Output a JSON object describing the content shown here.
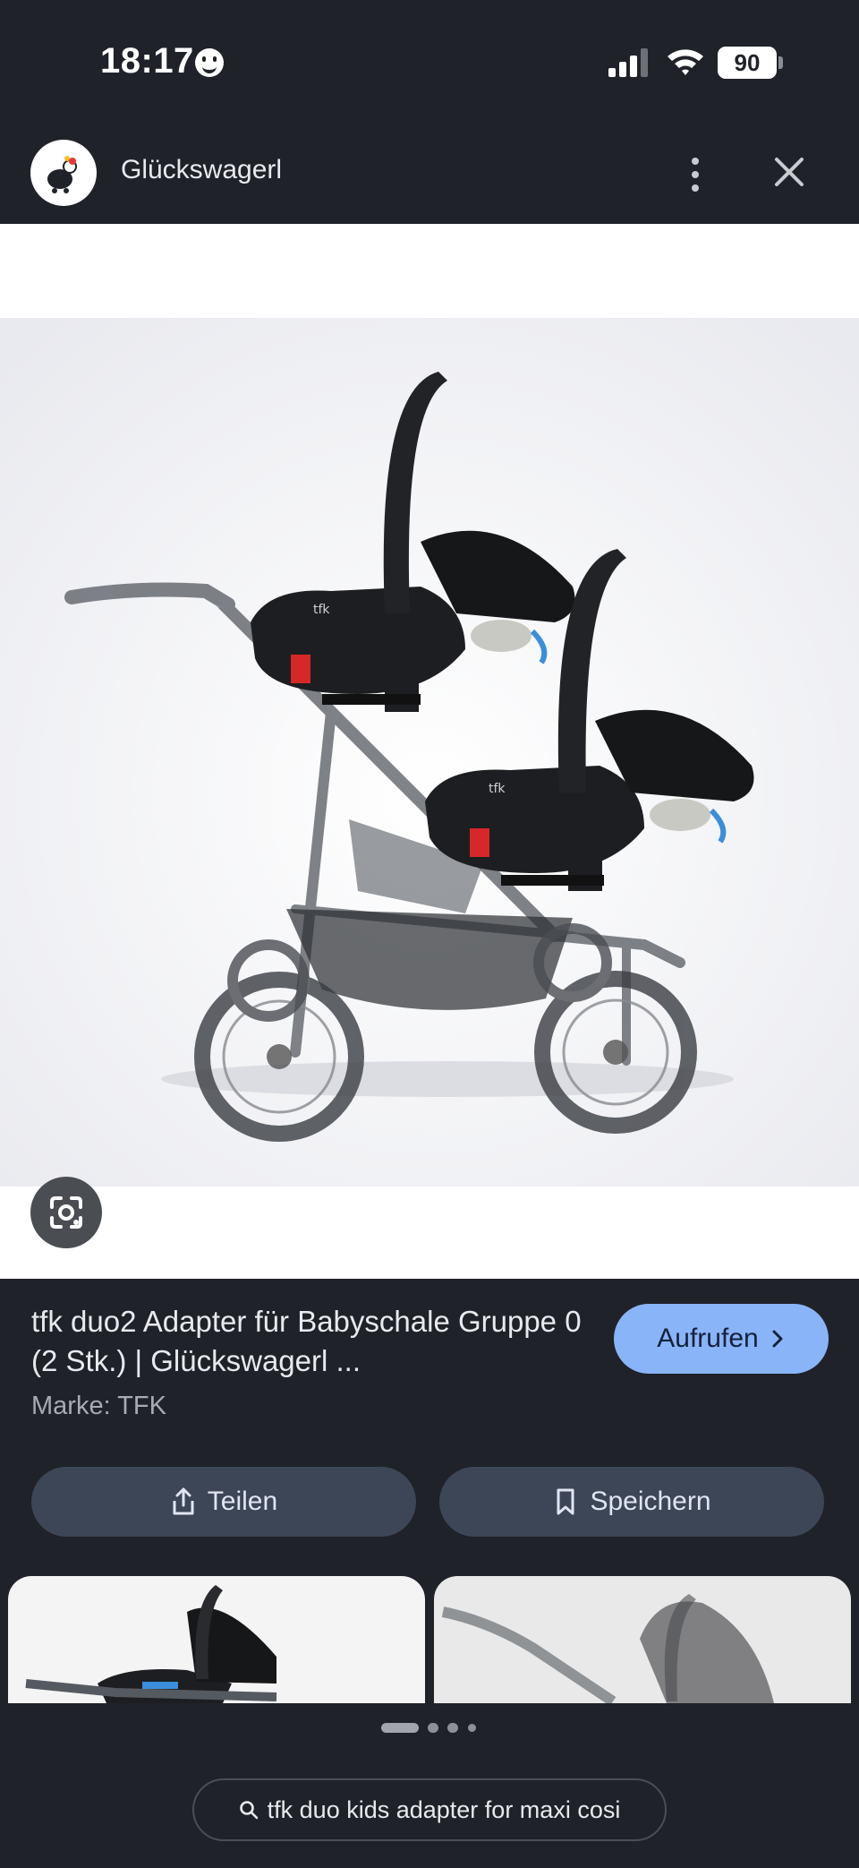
{
  "status_bar": {
    "time": "18:17",
    "battery": "90"
  },
  "header": {
    "site_name": "Glückswagerl"
  },
  "result": {
    "title": "tfk duo2 Adapter für Babyschale Gruppe 0 (2 Stk.) | Glückswagerl ...",
    "brand": "Marke: TFK",
    "visit_label": "Aufrufen"
  },
  "actions": {
    "share_label": "Teilen",
    "save_label": "Speichern"
  },
  "image_logo_text": "tfk",
  "search": {
    "query": "tfk duo kids adapter for maxi cosi"
  },
  "pagination": {
    "pages": 4,
    "current": 1
  },
  "icons": [
    "smiley-icon",
    "signal-icon",
    "wifi-icon",
    "more-vert-icon",
    "close-icon",
    "lens-icon",
    "chevron-right-icon",
    "share-icon",
    "bookmark-icon",
    "search-icon"
  ],
  "colors": {
    "background": "#1f2228",
    "accent": "#8ab4f8",
    "button": "#3c4657"
  }
}
